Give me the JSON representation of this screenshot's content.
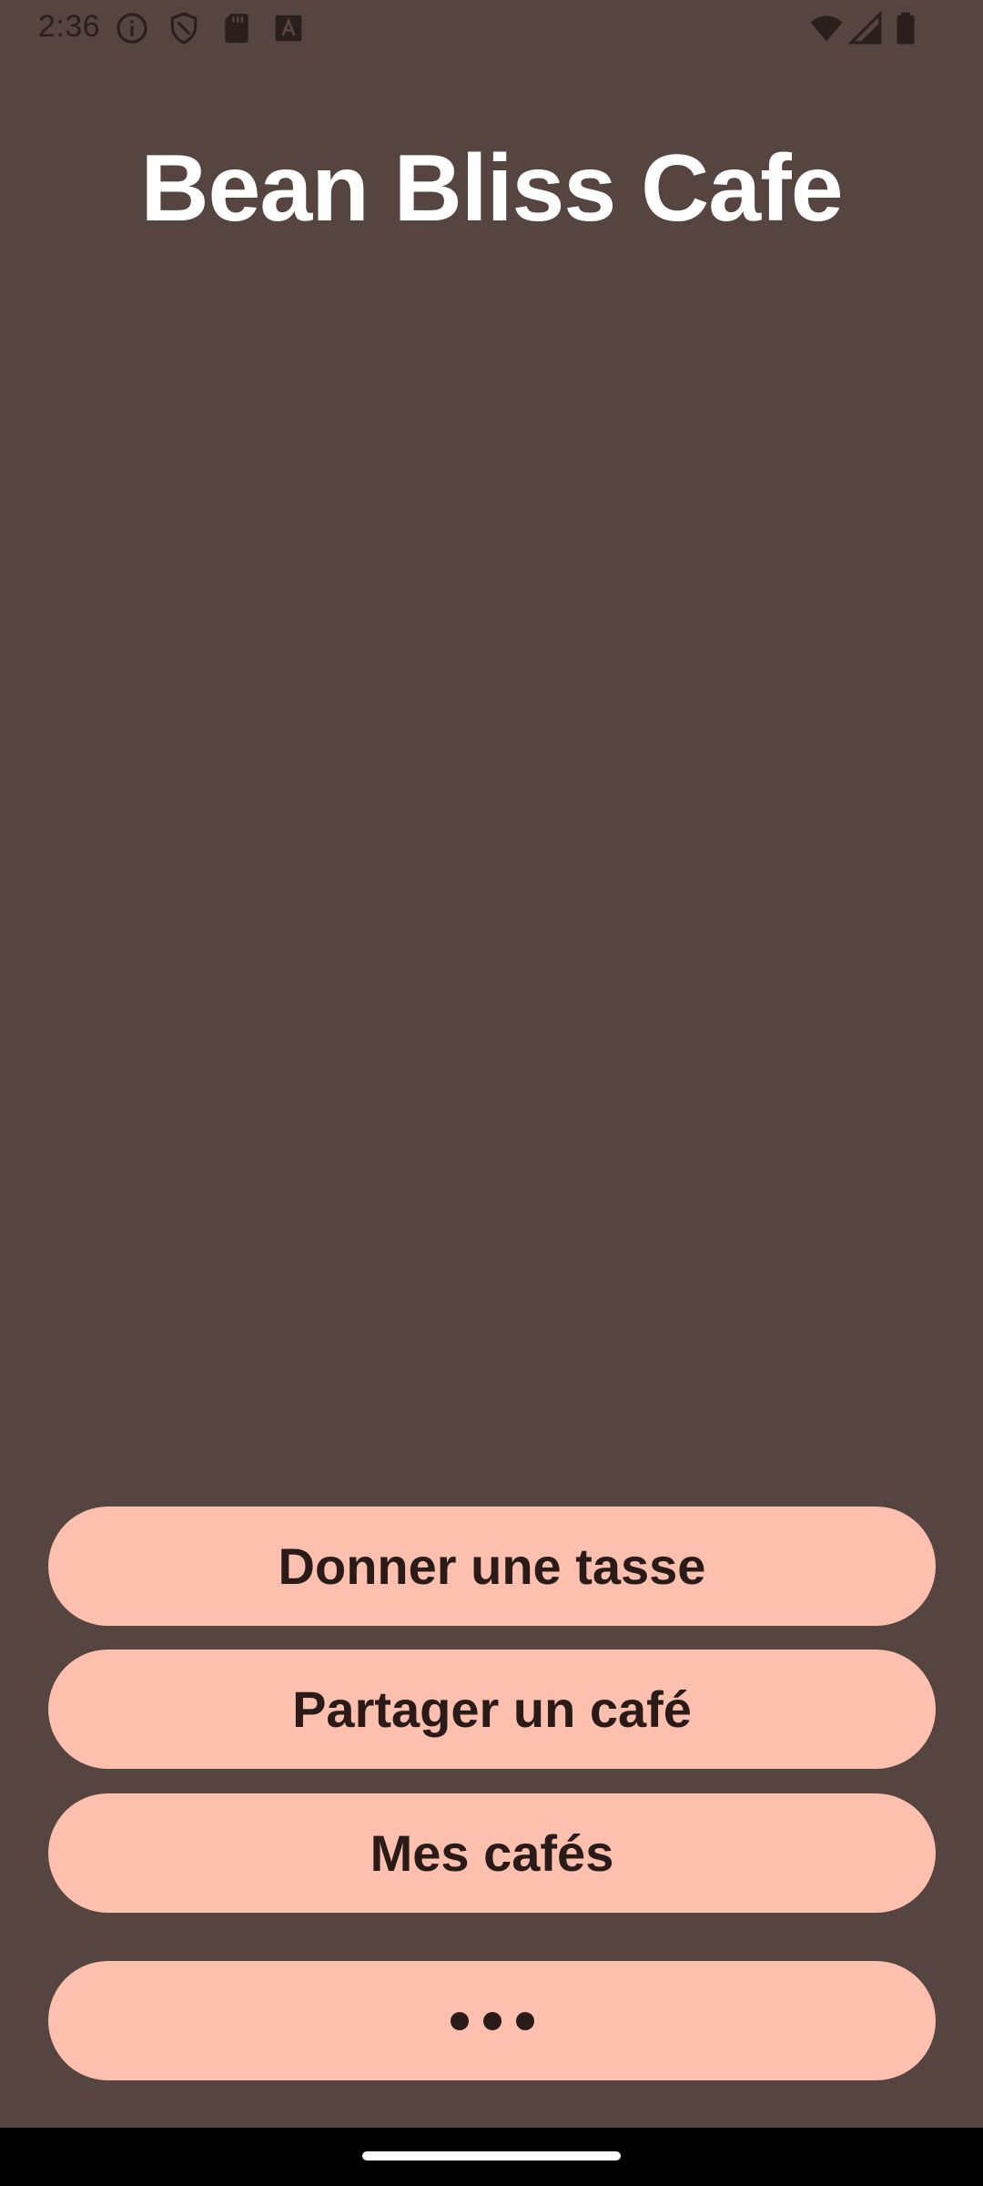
{
  "status_bar": {
    "time": "2:36",
    "left_icons": [
      "info-icon",
      "shield-icon",
      "sd-card-icon",
      "font-a-icon"
    ],
    "right_icons": [
      "wifi-icon",
      "signal-icon",
      "battery-icon"
    ]
  },
  "app": {
    "title": "Bean Bliss Cafe"
  },
  "actions": {
    "donate_label": "Donner une tasse",
    "share_label": "Partager un café",
    "my_coffees_label": "Mes cafés",
    "more_icon": "more-horizontal-icon"
  },
  "colors": {
    "background": "#564440",
    "button": "#fdbfae",
    "button_text": "#2a1b18",
    "title": "#ffffff"
  }
}
